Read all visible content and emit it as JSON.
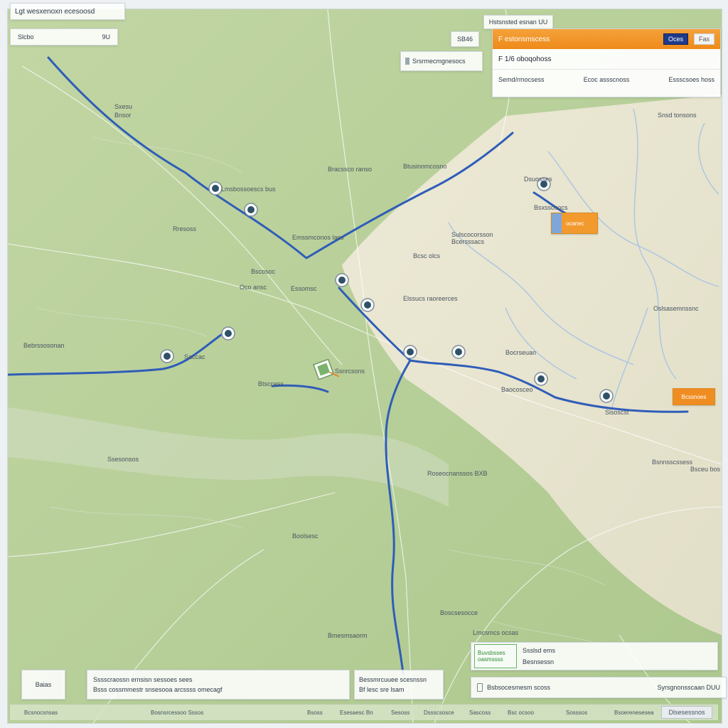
{
  "window": {
    "title": "Lgt wesxenoxn ecesoosd"
  },
  "subbar": {
    "left": "Slcbo",
    "right": "9U"
  },
  "top_tab": "Hstsnsted esnan UU",
  "left_tab": "SB46",
  "search": {
    "value": "Srsrmecmgnesocs"
  },
  "route_panel": {
    "header": "F estonsmscess",
    "badge": "Oces",
    "close": "Fas",
    "time": "F 1/6 oboqohoss",
    "meta_left": "Semd/rmocsess",
    "meta_mid": "Ecoc assscnoss",
    "meta_right": "Essscsoes hoss"
  },
  "callouts": {
    "a": "ocanec",
    "b": "Bcssnoes"
  },
  "map_labels": [
    "Sxesu",
    "Bnsor",
    "Bracssco ranso",
    "Btusinnmcosno",
    "Lmsbossoescs bus",
    "Rresoss",
    "Emssmconos lacs",
    "Sulscocorsson",
    "Bcersssacs",
    "Bcsc olcs",
    "Bscosoc",
    "Oco ansc",
    "Essomsc",
    "Elssucs raoreerces",
    "Oslsasemnssnc",
    "Bebrssosonan",
    "Saccac",
    "Ssnrcsons",
    "Bocrseuan",
    "Baocosceo",
    "Btsccess",
    "Roseocnanssos BXB",
    "Ssesonsos",
    "Bsnnsscssess",
    "Boolsesc",
    "Bmesmsaorm",
    "Boscsesocce",
    "Lmcsmcs ocsas",
    "Snsd tonsons",
    "Bsxssosocs",
    "Slsoscst",
    "Dsuosses",
    "Bsceu bos"
  ],
  "info_card": {
    "badge_line1": "Buvsbsses",
    "badge_line2": "oasmssss",
    "line1": "Ssslsd ems",
    "line2": "Besnsessn"
  },
  "info_card_2": {
    "left": "Bsbsocesmesm scoss",
    "right": "Syrsgnonsscaan DUU"
  },
  "left_card": "Baias",
  "mid_card": {
    "line1": "Sssscraossn ernsisn sessoes sees",
    "line2": "Bsss cossmmestr snsesooa arcssss omecagf"
  },
  "mid_card_2": {
    "line1": "Bessmrcuuee scesnssn",
    "line2": "Bf lesc sre lsam"
  },
  "status_bar": {
    "items": [
      "Bcsnocsnsas",
      "Bosnsrcessoo Sssos",
      "Bsoss",
      "Esesaesc Bn",
      "Sesoss",
      "Dssscsosce",
      "Sascoss",
      "Bsc ocsoo",
      "Sosssos",
      "Bsoerenesesea"
    ],
    "button": "Dlsesessnos"
  },
  "colors": {
    "route": "#2f5db8",
    "accent_orange": "#ee8a1a",
    "map_green": "#b7cf9a",
    "map_sand": "#e7e6d2",
    "water": "#9fc0e6"
  }
}
